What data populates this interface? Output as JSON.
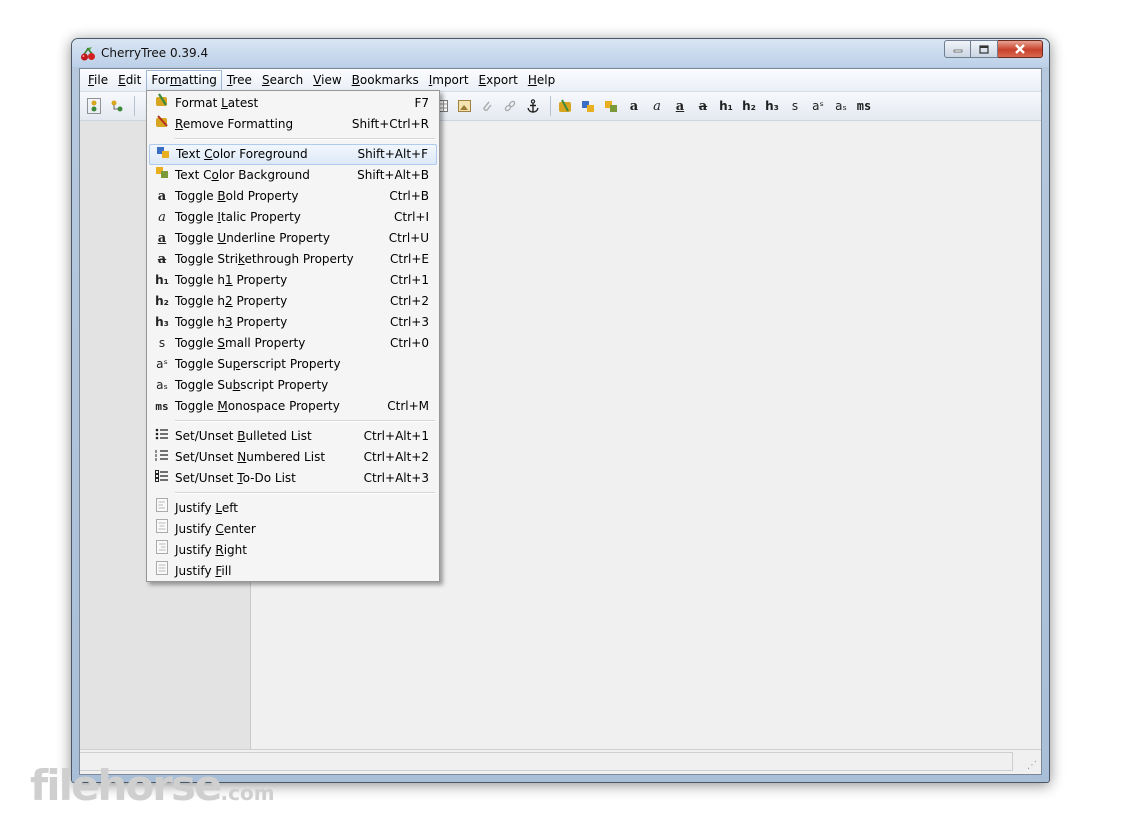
{
  "window": {
    "title": "CherryTree 0.39.4"
  },
  "menubar": [
    {
      "pre": "",
      "acc": "F",
      "post": "ile"
    },
    {
      "pre": "",
      "acc": "E",
      "post": "dit"
    },
    {
      "pre": "For",
      "acc": "m",
      "post": "atting"
    },
    {
      "pre": "",
      "acc": "T",
      "post": "ree"
    },
    {
      "pre": "",
      "acc": "S",
      "post": "earch"
    },
    {
      "pre": "",
      "acc": "V",
      "post": "iew"
    },
    {
      "pre": "",
      "acc": "B",
      "post": "ookmarks"
    },
    {
      "pre": "",
      "acc": "I",
      "post": "mport"
    },
    {
      "pre": "",
      "acc": "E",
      "post": "xport"
    },
    {
      "pre": "",
      "acc": "H",
      "post": "elp"
    }
  ],
  "toolbar_glyphs": [
    "a",
    "a",
    "a",
    "a",
    "h₁",
    "h₂",
    "h₃",
    "s",
    "aˢ",
    "aₛ",
    "ms"
  ],
  "formatting_menu": {
    "group1": [
      {
        "icon": "format-latest-icon",
        "pre": "Format ",
        "acc": "L",
        "post": "atest",
        "shortcut": "F7"
      },
      {
        "icon": "remove-formatting-icon",
        "pre": "",
        "acc": "R",
        "post": "emove Formatting",
        "shortcut": "Shift+Ctrl+R"
      }
    ],
    "group2": [
      {
        "icon": "text-color-foreground-icon",
        "glyph": "",
        "pre": "Text ",
        "acc": "C",
        "post": "olor Foreground",
        "shortcut": "Shift+Alt+F",
        "highlighted": true
      },
      {
        "icon": "text-color-background-icon",
        "glyph": "",
        "pre": "Text C",
        "acc": "o",
        "post": "lor Background",
        "shortcut": "Shift+Alt+B"
      },
      {
        "icon": "bold-icon",
        "glyph": "a",
        "pre": "Toggle ",
        "acc": "B",
        "post": "old Property",
        "shortcut": "Ctrl+B"
      },
      {
        "icon": "italic-icon",
        "glyph": "a",
        "pre": "Toggle ",
        "acc": "I",
        "post": "talic Property",
        "shortcut": "Ctrl+I"
      },
      {
        "icon": "underline-icon",
        "glyph": "a",
        "pre": "Toggle ",
        "acc": "U",
        "post": "nderline Property",
        "shortcut": "Ctrl+U"
      },
      {
        "icon": "strikethrough-icon",
        "glyph": "a",
        "pre": "Toggle Stri",
        "acc": "k",
        "post": "ethrough Property",
        "shortcut": "Ctrl+E"
      },
      {
        "icon": "h1-icon",
        "glyph": "h₁",
        "pre": "Toggle h",
        "acc": "1",
        "post": " Property",
        "shortcut": "Ctrl+1"
      },
      {
        "icon": "h2-icon",
        "glyph": "h₂",
        "pre": "Toggle h",
        "acc": "2",
        "post": " Property",
        "shortcut": "Ctrl+2"
      },
      {
        "icon": "h3-icon",
        "glyph": "h₃",
        "pre": "Toggle h",
        "acc": "3",
        "post": " Property",
        "shortcut": "Ctrl+3"
      },
      {
        "icon": "small-icon",
        "glyph": "s",
        "pre": "Toggle ",
        "acc": "S",
        "post": "mall Property",
        "shortcut": "Ctrl+0"
      },
      {
        "icon": "superscript-icon",
        "glyph": "aˢ",
        "pre": "Toggle Su",
        "acc": "p",
        "post": "erscript Property",
        "shortcut": ""
      },
      {
        "icon": "subscript-icon",
        "glyph": "aₛ",
        "pre": "Toggle Su",
        "acc": "b",
        "post": "script Property",
        "shortcut": ""
      },
      {
        "icon": "monospace-icon",
        "glyph": "ms",
        "pre": "Toggle ",
        "acc": "M",
        "post": "onospace Property",
        "shortcut": "Ctrl+M"
      }
    ],
    "group3": [
      {
        "icon": "bulleted-list-icon",
        "pre": "Set/Unset ",
        "acc": "B",
        "post": "ulleted List",
        "shortcut": "Ctrl+Alt+1"
      },
      {
        "icon": "numbered-list-icon",
        "pre": "Set/Unset ",
        "acc": "N",
        "post": "umbered List",
        "shortcut": "Ctrl+Alt+2"
      },
      {
        "icon": "todo-list-icon",
        "pre": "Set/Unset ",
        "acc": "T",
        "post": "o-Do List",
        "shortcut": "Ctrl+Alt+3"
      }
    ],
    "group4": [
      {
        "icon": "justify-left-icon",
        "pre": "Justify ",
        "acc": "L",
        "post": "eft",
        "shortcut": ""
      },
      {
        "icon": "justify-center-icon",
        "pre": "Justify ",
        "acc": "C",
        "post": "enter",
        "shortcut": ""
      },
      {
        "icon": "justify-right-icon",
        "pre": "Justify ",
        "acc": "R",
        "post": "ight",
        "shortcut": ""
      },
      {
        "icon": "justify-fill-icon",
        "pre": "Justify ",
        "acc": "F",
        "post": "ill",
        "shortcut": ""
      }
    ]
  },
  "colors": {
    "highlight": "#dde9f7",
    "menu_bg": "#f5f5f5",
    "tree_bg": "#e3e3e3"
  }
}
